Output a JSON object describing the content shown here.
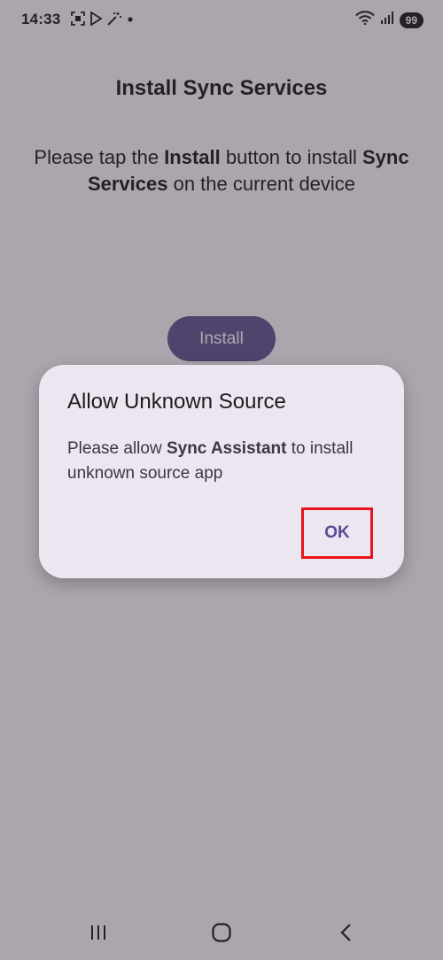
{
  "status_bar": {
    "time": "14:33",
    "battery": "99",
    "icons_left": [
      "screenshot-icon",
      "play-store-icon",
      "magic-wand-icon",
      "notification-dot-icon"
    ],
    "icons_right": [
      "wifi-icon",
      "signal-icon",
      "battery-icon"
    ]
  },
  "main": {
    "title": "Install Sync Services",
    "instruction": {
      "prefix": "Please tap the ",
      "bold1": "Install",
      "middle": " button to install ",
      "bold2": "Sync Services",
      "suffix": " on the current device"
    },
    "install_label": "Install"
  },
  "dialog": {
    "title": "Allow Unknown Source",
    "message": {
      "prefix": "Please allow ",
      "bold": "Sync Assistant",
      "suffix": " to install unknown source app"
    },
    "ok_label": "OK"
  },
  "nav_bar": {
    "buttons": [
      "recent-apps-icon",
      "home-icon",
      "back-icon"
    ]
  },
  "colors": {
    "accent": "#65558f",
    "dialog_bg": "#ece6f0",
    "highlight": "#e8141c"
  }
}
